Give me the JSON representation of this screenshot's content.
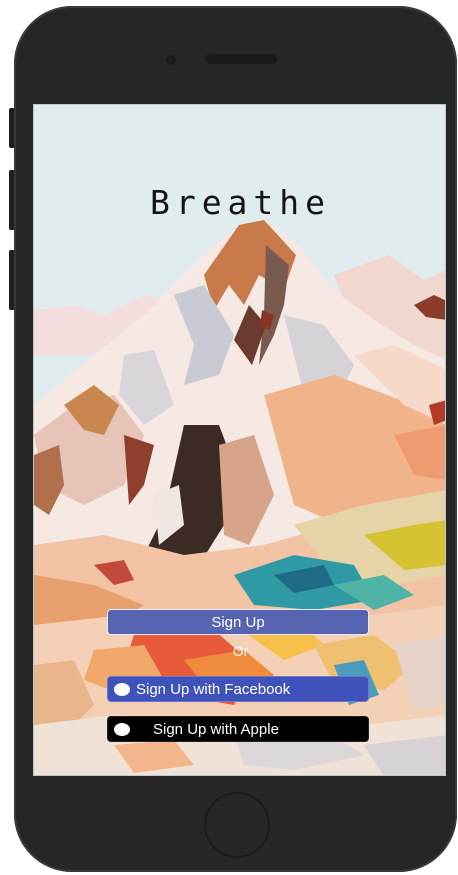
{
  "app": {
    "title": "Breathe"
  },
  "buttons": {
    "signup_label": "Sign Up",
    "or_label": "Or",
    "facebook_label": "Sign Up with Facebook",
    "apple_label": "Sign Up with Apple"
  },
  "icons": {
    "facebook": "circle-icon",
    "apple": "circle-icon"
  },
  "colors": {
    "signup_button": "#5563b0",
    "facebook_button": "#3f51bb",
    "apple_button": "#000000",
    "sky": "#e1ecee"
  }
}
